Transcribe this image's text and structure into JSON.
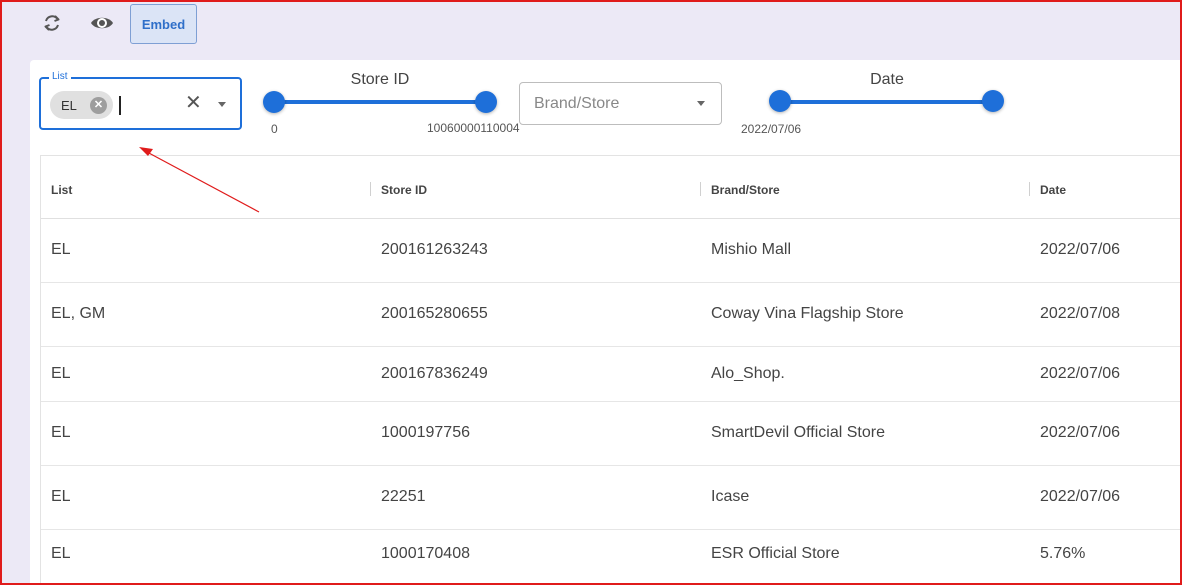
{
  "toolbar": {
    "refresh_icon": "refresh-icon",
    "preview_icon": "eye-icon",
    "embed_label": "Embed"
  },
  "filters": {
    "list": {
      "legend": "List",
      "chips": [
        "EL"
      ],
      "value": ""
    },
    "store_id": {
      "title": "Store ID",
      "min_label": "0",
      "max_label": "10060000110004"
    },
    "brand_store": {
      "placeholder": "Brand/Store"
    },
    "date": {
      "title": "Date",
      "min_label": "2022/07/06"
    }
  },
  "table": {
    "columns": [
      "List",
      "Store ID",
      "Brand/Store",
      "Date"
    ],
    "rows": [
      [
        "EL",
        "200161263243",
        "Mishio Mall",
        "2022/07/06"
      ],
      [
        "EL, GM",
        "200165280655",
        "Coway Vina Flagship Store",
        "2022/07/08"
      ],
      [
        "EL",
        "200167836249",
        "Alo_Shop.",
        "2022/07/06"
      ],
      [
        "EL",
        "1000197756",
        "SmartDevil Official Store",
        "2022/07/06"
      ],
      [
        "EL",
        "22251",
        "Icase",
        "2022/07/06"
      ],
      [
        "EL",
        "1000170408",
        "ESR Official Store",
        "5.76%"
      ]
    ]
  },
  "colors": {
    "accent": "#1e6fd9",
    "annotation_border": "#e01b1b",
    "annotation_arrow": "#e01b1b",
    "background": "#ece9f6"
  }
}
